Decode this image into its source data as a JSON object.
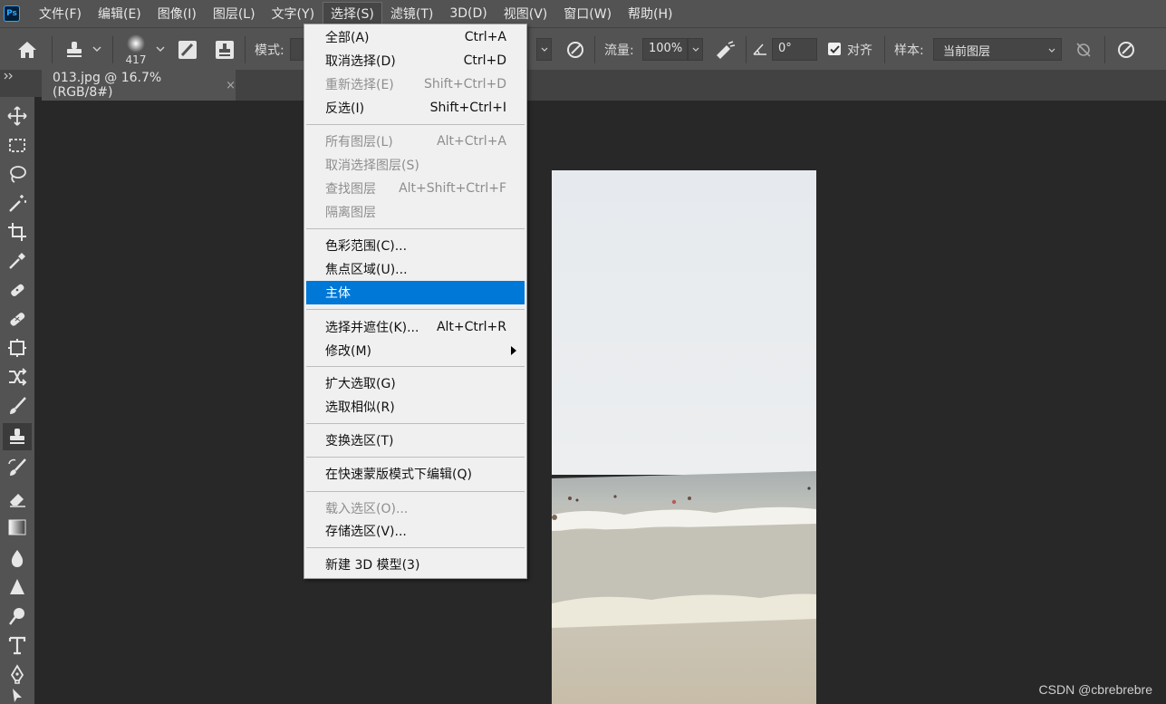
{
  "app": {
    "logo_text": "Ps"
  },
  "menubar": [
    {
      "label": "文件(F)"
    },
    {
      "label": "编辑(E)"
    },
    {
      "label": "图像(I)"
    },
    {
      "label": "图层(L)"
    },
    {
      "label": "文字(Y)"
    },
    {
      "label": "选择(S)"
    },
    {
      "label": "滤镜(T)"
    },
    {
      "label": "3D(D)"
    },
    {
      "label": "视图(V)"
    },
    {
      "label": "窗口(W)"
    },
    {
      "label": "帮助(H)"
    }
  ],
  "options": {
    "brush_size": "417",
    "mode_label": "模式:",
    "flow_label": "流量:",
    "flow_value": "100%",
    "angle_value": "0°",
    "align_label": "对齐",
    "align_checked": true,
    "sample_label": "样本:",
    "sample_value": "当前图层"
  },
  "document": {
    "tab_title": "013.jpg @ 16.7%(RGB/8#)",
    "close_glyph": "×"
  },
  "select_menu": {
    "group1": [
      {
        "label": "全部(A)",
        "shortcut": "Ctrl+A",
        "enabled": true
      },
      {
        "label": "取消选择(D)",
        "shortcut": "Ctrl+D",
        "enabled": true
      },
      {
        "label": "重新选择(E)",
        "shortcut": "Shift+Ctrl+D",
        "enabled": false
      },
      {
        "label": "反选(I)",
        "shortcut": "Shift+Ctrl+I",
        "enabled": true
      }
    ],
    "group2": [
      {
        "label": "所有图层(L)",
        "shortcut": "Alt+Ctrl+A",
        "enabled": false
      },
      {
        "label": "取消选择图层(S)",
        "shortcut": "",
        "enabled": false
      },
      {
        "label": "查找图层",
        "shortcut": "Alt+Shift+Ctrl+F",
        "enabled": false
      },
      {
        "label": "隔离图层",
        "shortcut": "",
        "enabled": false
      }
    ],
    "group3": [
      {
        "label": "色彩范围(C)...",
        "shortcut": "",
        "enabled": true
      },
      {
        "label": "焦点区域(U)...",
        "shortcut": "",
        "enabled": true
      },
      {
        "label": "主体",
        "shortcut": "",
        "enabled": true,
        "highlighted": true
      }
    ],
    "group4": [
      {
        "label": "选择并遮住(K)...",
        "shortcut": "Alt+Ctrl+R",
        "enabled": true
      },
      {
        "label": "修改(M)",
        "shortcut": "",
        "enabled": true,
        "submenu": true
      }
    ],
    "group5": [
      {
        "label": "扩大选取(G)",
        "shortcut": "",
        "enabled": true
      },
      {
        "label": "选取相似(R)",
        "shortcut": "",
        "enabled": true
      }
    ],
    "group6": [
      {
        "label": "变换选区(T)",
        "shortcut": "",
        "enabled": true
      }
    ],
    "group7": [
      {
        "label": "在快速蒙版模式下编辑(Q)",
        "shortcut": "",
        "enabled": true
      }
    ],
    "group8": [
      {
        "label": "载入选区(O)...",
        "shortcut": "",
        "enabled": false
      },
      {
        "label": "存储选区(V)...",
        "shortcut": "",
        "enabled": true
      }
    ],
    "group9": [
      {
        "label": "新建 3D 模型(3)",
        "shortcut": "",
        "enabled": true
      }
    ]
  },
  "tools": [
    {
      "icon": "move-tool-icon"
    },
    {
      "icon": "marquee-tool-icon"
    },
    {
      "icon": "lasso-tool-icon"
    },
    {
      "icon": "magic-wand-tool-icon"
    },
    {
      "icon": "crop-tool-icon"
    },
    {
      "icon": "eyedropper-tool-icon"
    },
    {
      "icon": "spot-healing-tool-icon"
    },
    {
      "icon": "healing-brush-tool-icon"
    },
    {
      "icon": "patch-tool-icon"
    },
    {
      "icon": "content-aware-move-tool-icon"
    },
    {
      "icon": "brush-tool-icon"
    },
    {
      "icon": "clone-stamp-tool-icon",
      "active": true
    },
    {
      "icon": "history-brush-tool-icon"
    },
    {
      "icon": "eraser-tool-icon"
    },
    {
      "icon": "gradient-tool-icon"
    },
    {
      "icon": "blur-tool-icon"
    },
    {
      "icon": "sharpen-tool-icon"
    },
    {
      "icon": "dodge-tool-icon"
    },
    {
      "icon": "type-tool-icon"
    },
    {
      "icon": "pen-tool-icon"
    },
    {
      "icon": "path-selection-tool-icon"
    }
  ],
  "watermark": "CSDN @cbrebrebre",
  "colors": {
    "highlight": "#0078d7",
    "sky": "#e8eaec",
    "sea": "#b8bbb6",
    "sand": "#c9c0ae"
  }
}
